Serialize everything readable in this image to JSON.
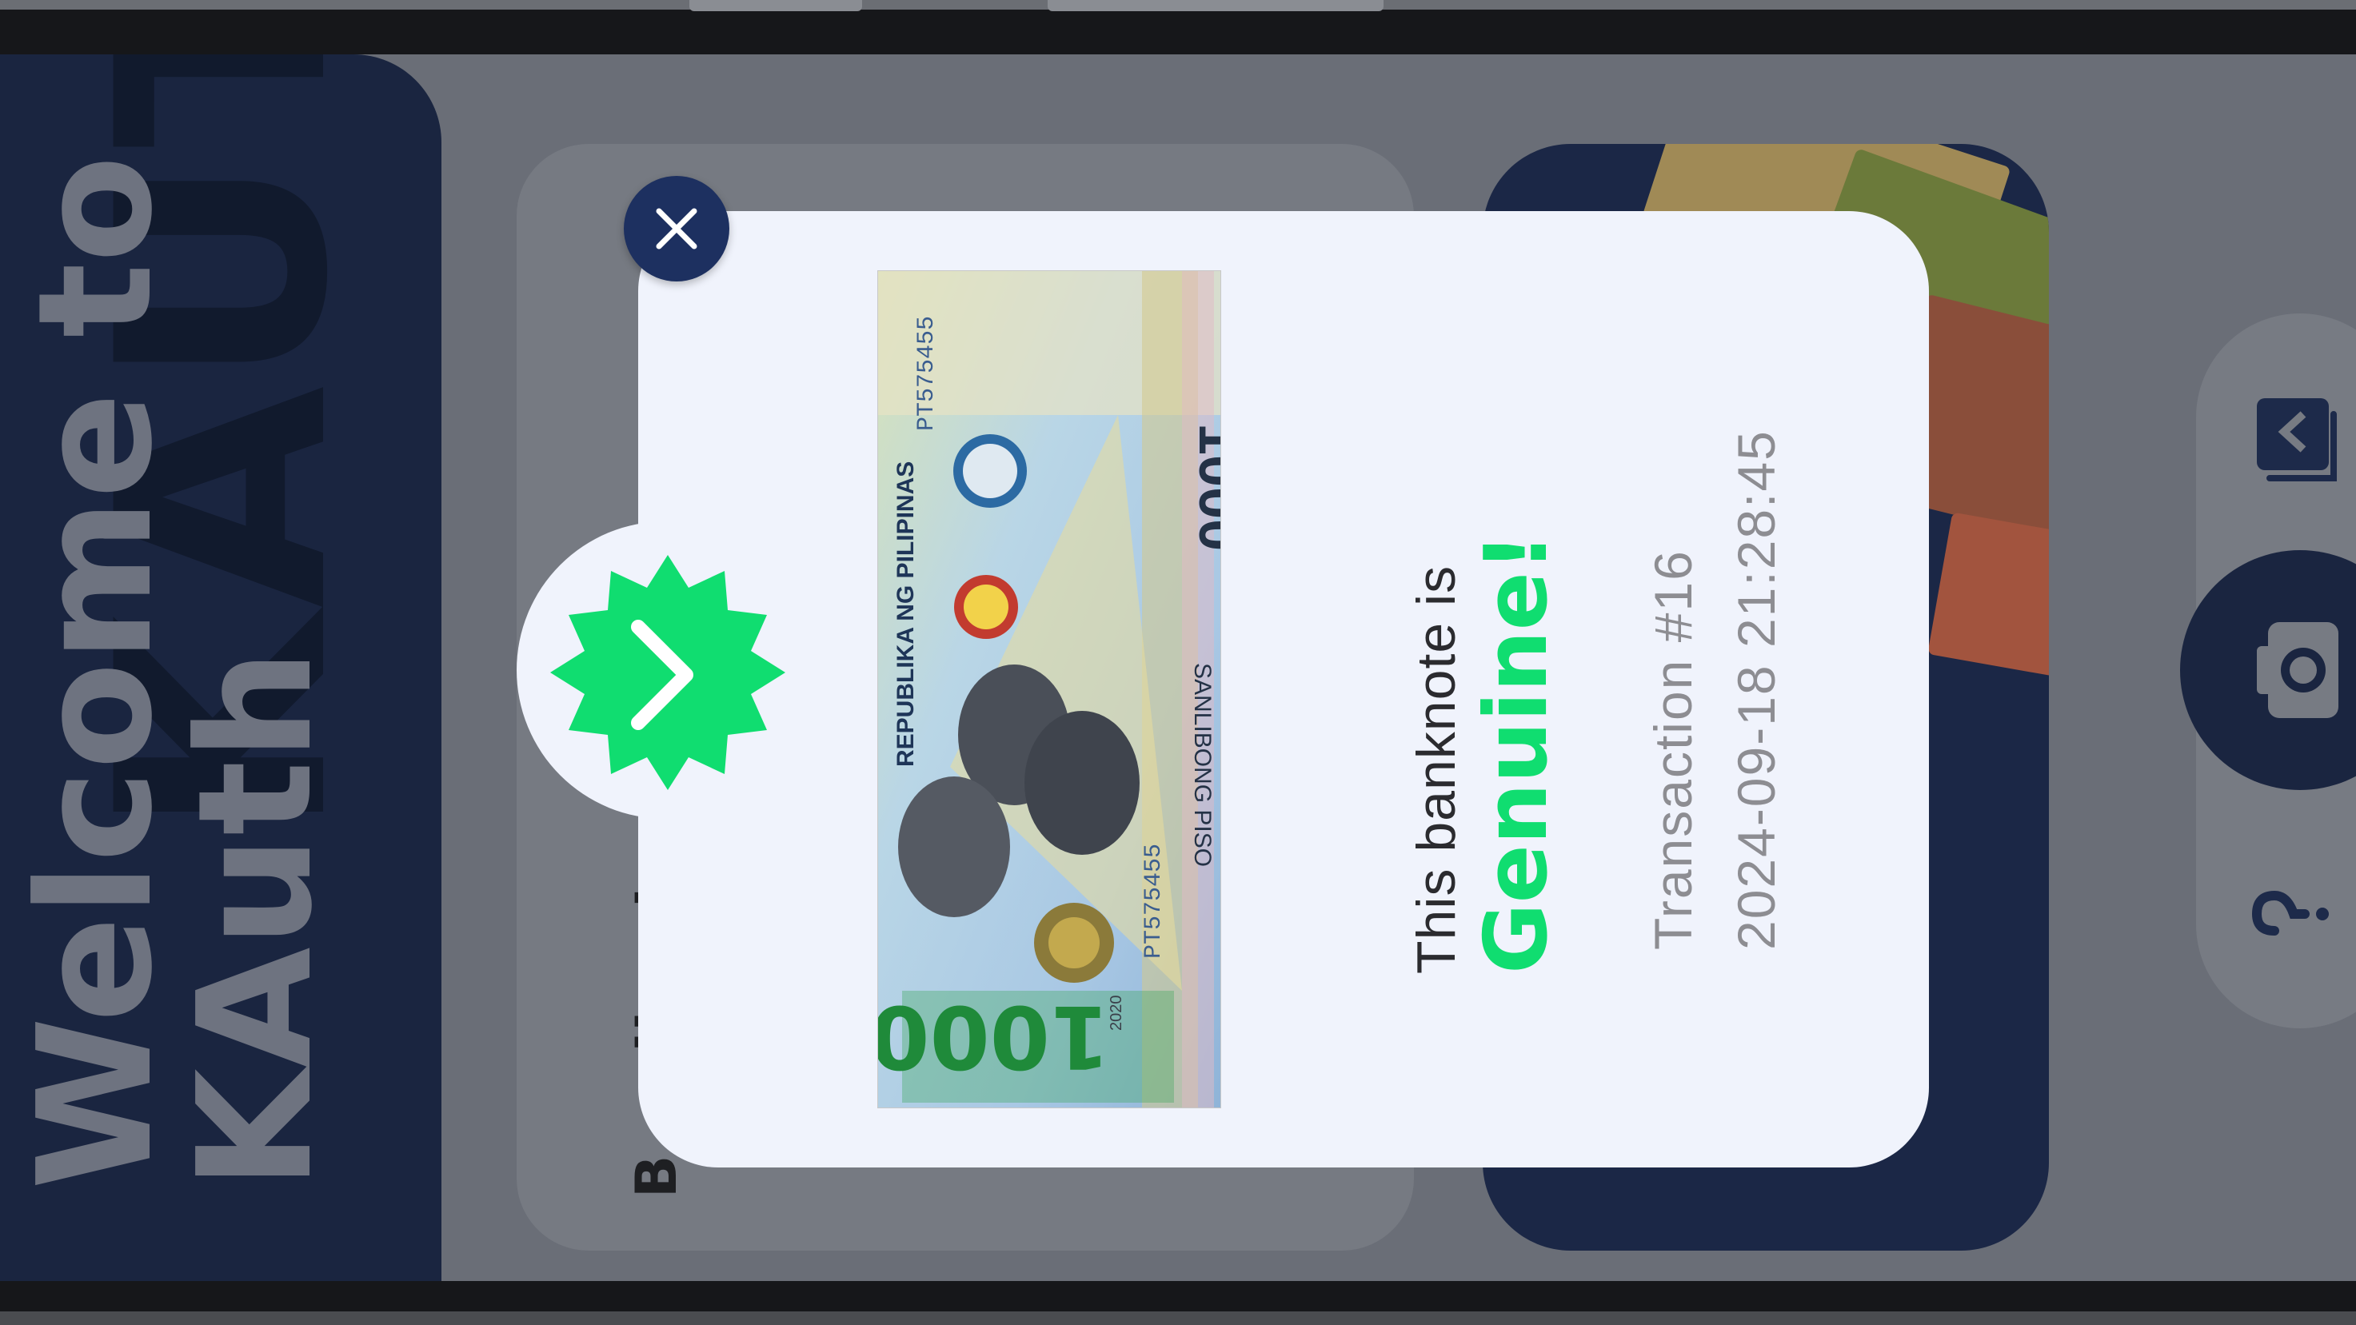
{
  "welcome": {
    "title_line1": "Welcome to",
    "title_line2": "KAuth",
    "watermark": "KAUTH"
  },
  "background_card": {
    "snippet": "B ... II ... I"
  },
  "modal": {
    "result_prefix": "This banknote is",
    "verdict": "Genuine!",
    "transaction_label": "Transaction #16",
    "timestamp": "2024-09-18 21:28:45"
  },
  "banknote": {
    "country": "REPUBLIKA NG PILIPINAS",
    "denomination": "1000",
    "denomination_words": "SANLIBONG PISO",
    "serial": "PT575455",
    "year": "2020"
  },
  "icons": {
    "close": "close-icon",
    "verified": "verified-badge-icon",
    "gallery": "gallery-icon",
    "camera": "camera-icon",
    "help": "help-icon"
  },
  "colors": {
    "accent_green": "#10dd70",
    "navy": "#1d3060",
    "modal_bg": "#f0f3fc"
  }
}
